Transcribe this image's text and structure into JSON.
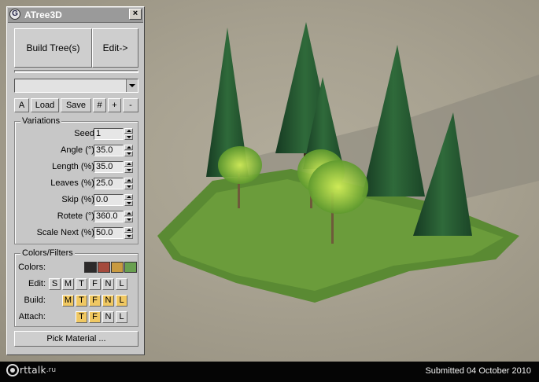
{
  "window": {
    "title": "ATree3D"
  },
  "main_buttons": {
    "build": "Build Tree(s)",
    "edit": "Edit->"
  },
  "toolbar": [
    "A",
    "Load",
    "Save",
    "#",
    "+",
    "-"
  ],
  "variations": {
    "title": "Variations",
    "fields": [
      {
        "label": "Seed:",
        "value": "1"
      },
      {
        "label": "Angle (°):",
        "value": "35.0"
      },
      {
        "label": "Length (%):",
        "value": "35.0"
      },
      {
        "label": "Leaves (%):",
        "value": "25.0"
      },
      {
        "label": "Skip (%):",
        "value": "0.0"
      },
      {
        "label": "Rotete (°):",
        "value": "360.0"
      },
      {
        "label": "Scale Next (%):",
        "value": "50.0"
      }
    ]
  },
  "colors_filters": {
    "title": "Colors/Filters",
    "colors_label": "Colors:",
    "colors": [
      "#2c2a2a",
      "#a54a3c",
      "#c99a40",
      "#69a050"
    ],
    "edit_label": "Edit:",
    "edit_buttons": [
      "S",
      "M",
      "T",
      "F",
      "N",
      "L"
    ],
    "build_label": "Build:",
    "build_buttons": [
      "M",
      "T",
      "F",
      "N",
      "L"
    ],
    "attach_label": "Attach:",
    "attach_buttons": [
      "T",
      "F",
      "N",
      "L"
    ]
  },
  "pick_material": "Pick Material ...",
  "footer": {
    "logo_text": "rttalk",
    "logo_tld": ".ru",
    "submitted": "Submitted 04 October 2010"
  },
  "colors": {
    "active_toggle": "#f0c862",
    "panel": "#c7c7c7",
    "title_bar": "#9a9a9a"
  }
}
